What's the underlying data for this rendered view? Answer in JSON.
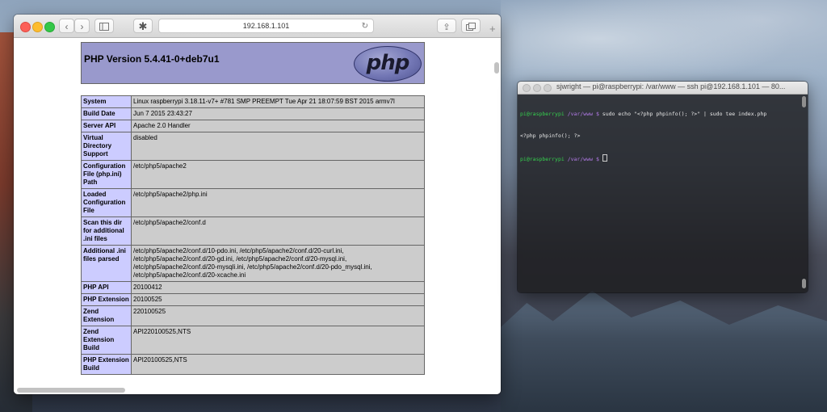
{
  "safari": {
    "url": "192.168.1.101",
    "toolbar": {
      "back_icon": "chevron-left-icon",
      "forward_icon": "chevron-right-icon",
      "sidebar_icon": "sidebar-icon",
      "extension_icon": "puzzle-icon",
      "reload_icon": "reload-icon",
      "share_icon": "share-icon",
      "tabs_icon": "tabs-icon",
      "new_tab_label": "+"
    },
    "php_title": "PHP Version 5.4.41-0+deb7u1",
    "php_logo_text": "php",
    "rows": [
      {
        "key": "System",
        "value": "Linux raspberrypi 3.18.11-v7+ #781 SMP PREEMPT Tue Apr 21 18:07:59 BST 2015 armv7l"
      },
      {
        "key": "Build Date",
        "value": "Jun 7 2015 23:43:27"
      },
      {
        "key": "Server API",
        "value": "Apache 2.0 Handler"
      },
      {
        "key": "Virtual Directory Support",
        "value": "disabled"
      },
      {
        "key": "Configuration File (php.ini) Path",
        "value": "/etc/php5/apache2"
      },
      {
        "key": "Loaded Configuration File",
        "value": "/etc/php5/apache2/php.ini"
      },
      {
        "key": "Scan this dir for additional .ini files",
        "value": "/etc/php5/apache2/conf.d"
      },
      {
        "key": "Additional .ini files parsed",
        "value": "/etc/php5/apache2/conf.d/10-pdo.ini, /etc/php5/apache2/conf.d/20-curl.ini, /etc/php5/apache2/conf.d/20-gd.ini, /etc/php5/apache2/conf.d/20-mysql.ini, /etc/php5/apache2/conf.d/20-mysqli.ini, /etc/php5/apache2/conf.d/20-pdo_mysql.ini, /etc/php5/apache2/conf.d/20-xcache.ini"
      },
      {
        "key": "PHP API",
        "value": "20100412"
      },
      {
        "key": "PHP Extension",
        "value": "20100525"
      },
      {
        "key": "Zend Extension",
        "value": "220100525"
      },
      {
        "key": "Zend Extension Build",
        "value": "API220100525,NTS"
      },
      {
        "key": "PHP Extension Build",
        "value": "API20100525,NTS"
      }
    ]
  },
  "terminal": {
    "title": "sjwright — pi@raspberrypi: /var/www — ssh pi@192.168.1.101 — 80...",
    "lines": [
      {
        "user": "pi@raspberrypi",
        "path": "/var/www",
        "prompt": "$",
        "text": " sudo echo \"<?php phpinfo(); ?>\" | sudo tee index.php"
      },
      {
        "output": "<?php phpinfo(); ?>"
      },
      {
        "user": "pi@raspberrypi",
        "path": "/var/www",
        "prompt": "$",
        "text": " "
      }
    ]
  }
}
